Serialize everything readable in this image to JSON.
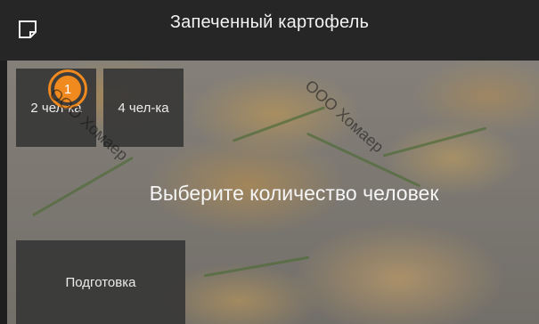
{
  "header": {
    "title": "Запеченный картофель",
    "icon": "note-icon"
  },
  "portions": [
    {
      "label": "2 чел-ка",
      "selected": true
    },
    {
      "label": "4 чел-ка",
      "selected": false
    }
  ],
  "badge": {
    "number": "1",
    "color": "#f0891e"
  },
  "prompt": "Выберите количество человек",
  "preparation_button": "Подготовка",
  "watermark": "ООО Хомаер"
}
